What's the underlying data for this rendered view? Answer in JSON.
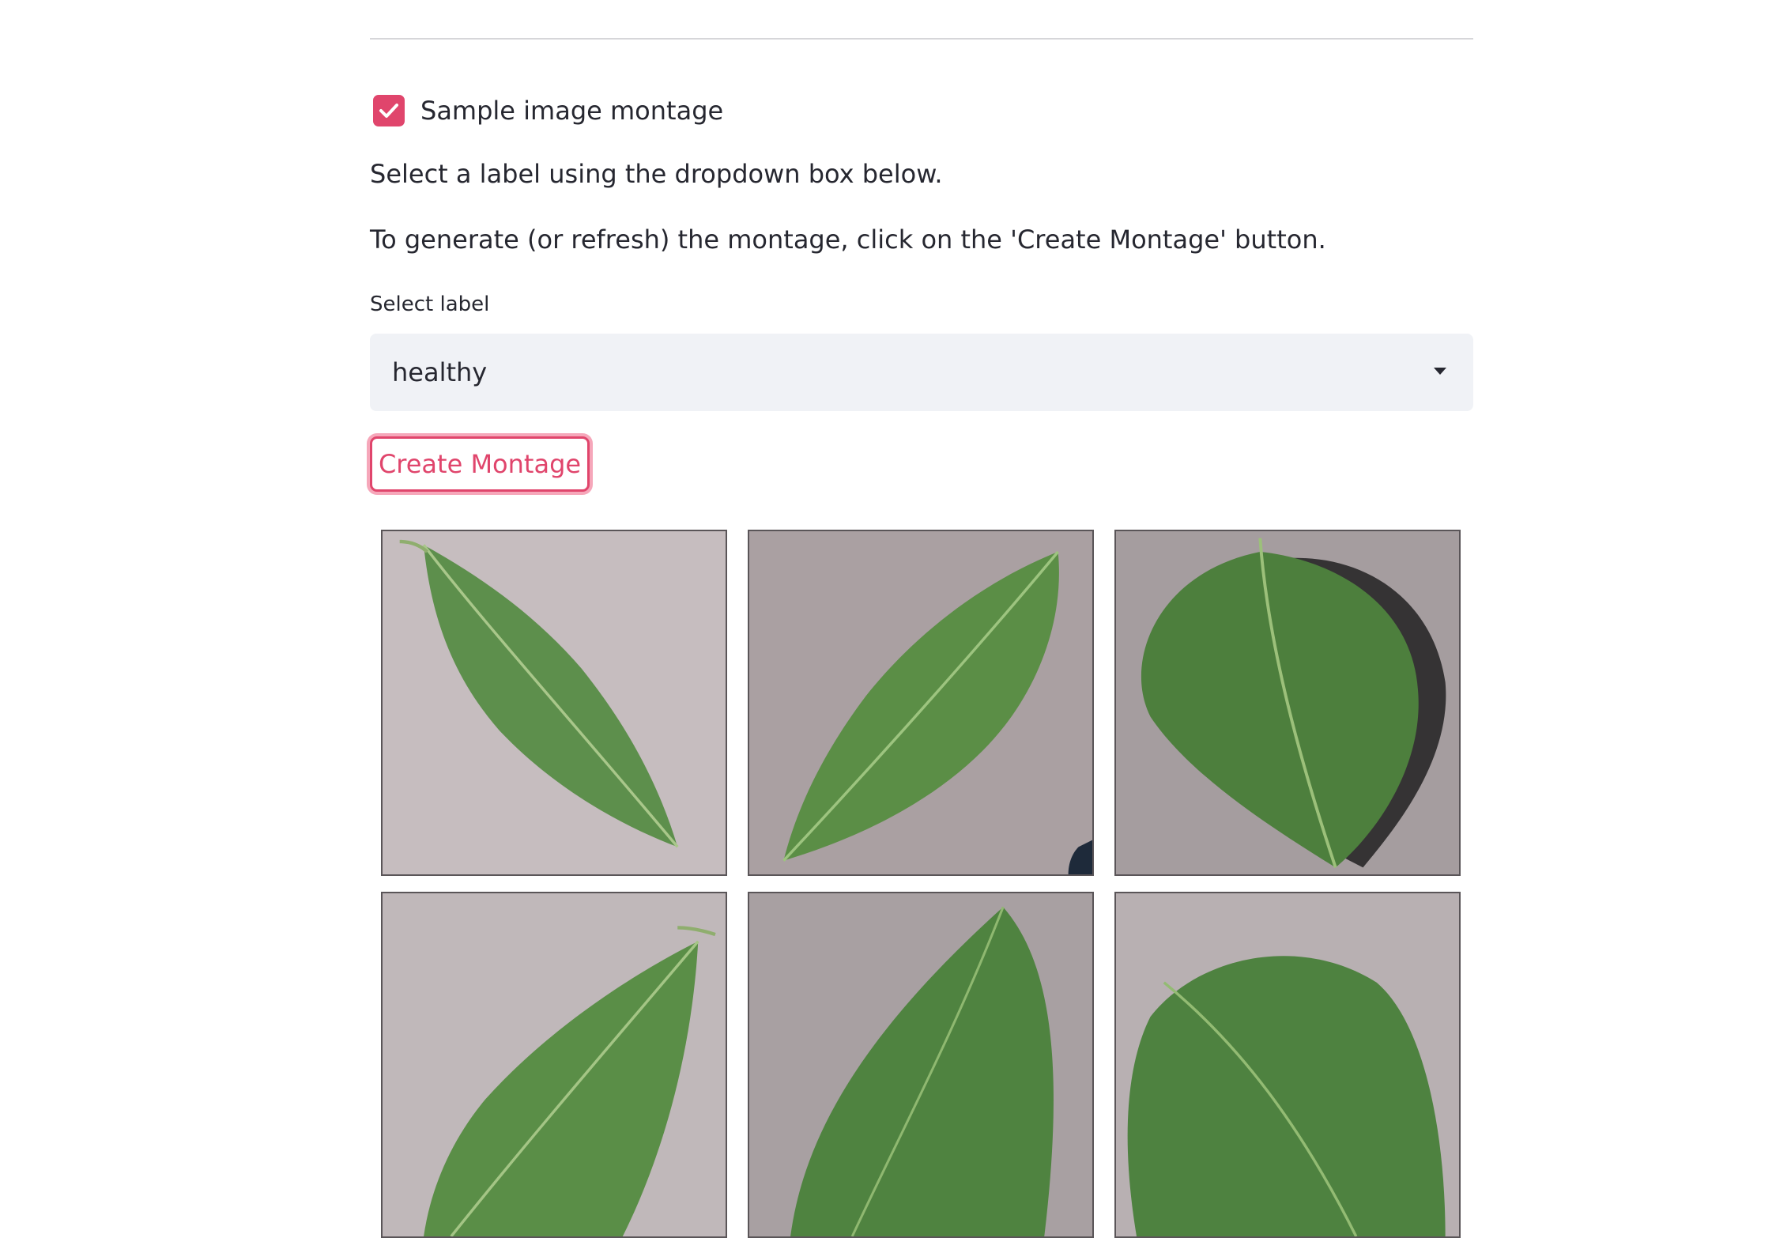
{
  "checkbox": {
    "label": "Sample image montage",
    "checked": true,
    "color": "#e0456c"
  },
  "instructions": {
    "line1": "Select a label using the dropdown box below.",
    "line2": "To generate (or refresh) the montage, click on the 'Create Montage' button."
  },
  "select": {
    "label": "Select label",
    "value": "healthy"
  },
  "button": {
    "label": "Create Montage"
  },
  "montage": {
    "images": [
      {
        "name": "healthy-leaf-1"
      },
      {
        "name": "healthy-leaf-2"
      },
      {
        "name": "healthy-leaf-3"
      },
      {
        "name": "healthy-leaf-4"
      },
      {
        "name": "healthy-leaf-5"
      },
      {
        "name": "healthy-leaf-6"
      }
    ]
  },
  "colors": {
    "accent": "#e0456c",
    "select_bg": "#f0f2f6",
    "leaf": "#5a8f4a",
    "background_grey": "#bfb7b8"
  }
}
